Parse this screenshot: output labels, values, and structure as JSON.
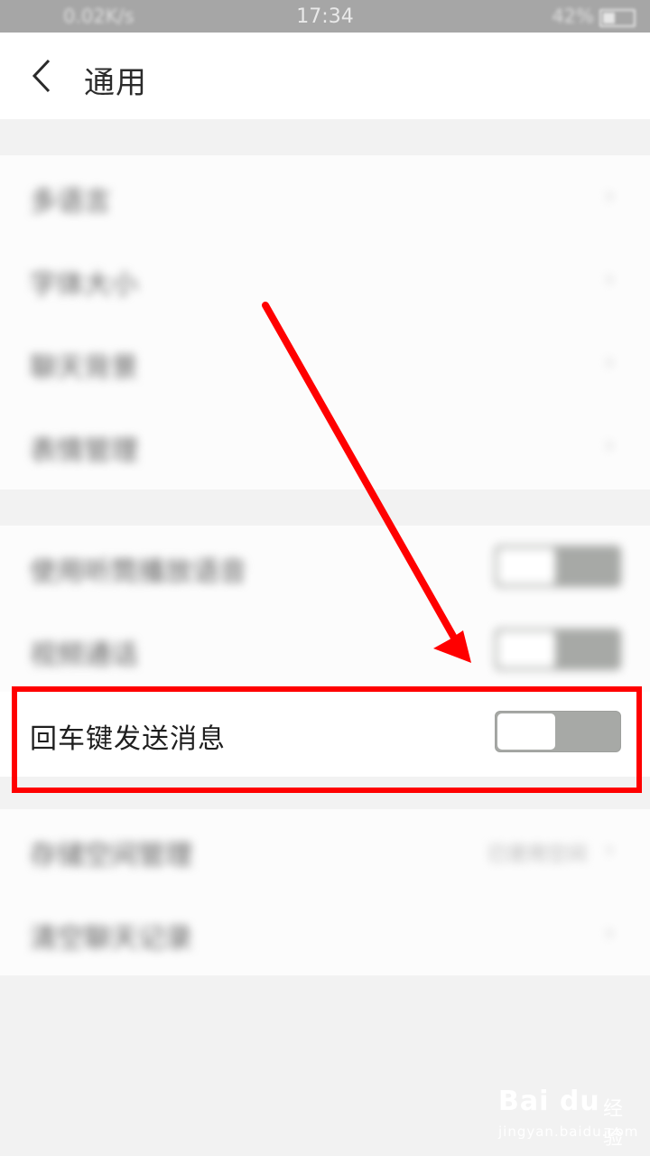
{
  "status_bar": {
    "left_text": "0.02K/s",
    "time": "17:34",
    "right_text": "42%",
    "battery_level": 0.42
  },
  "header": {
    "title": "通用"
  },
  "group1": [
    {
      "label": "多语言"
    },
    {
      "label": "字体大小"
    },
    {
      "label": "聊天背景"
    },
    {
      "label": "表情管理"
    }
  ],
  "group2": [
    {
      "label": "使用听筒播放语音",
      "on": false
    },
    {
      "label": "视频通话",
      "on": false
    }
  ],
  "focus_setting": {
    "label": "回车键发送消息",
    "on": false
  },
  "group3": [
    {
      "label": "存储空间管理",
      "value": "已使用空间"
    },
    {
      "label": "清空聊天记录",
      "value": ""
    }
  ],
  "annotation": {
    "color": "#ff0000"
  },
  "watermark": {
    "brand": "Bai du",
    "sub": "经验",
    "url": "jingyan.baidu.com"
  }
}
